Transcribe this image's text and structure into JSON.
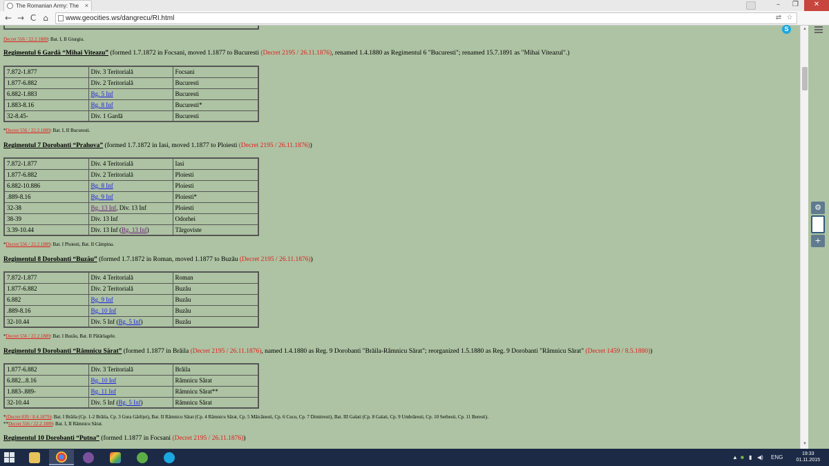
{
  "browser": {
    "tab_title": "The Romanian Army: The",
    "tab_close": "×",
    "url": "www.geocities.ws/dangrecu/RI.html",
    "nav": {
      "back": "←",
      "forward": "→",
      "reload": "C",
      "home": "⌂"
    },
    "window": {
      "minimize": "–",
      "maximize": "❐",
      "close": "✕"
    },
    "skype_label": "S"
  },
  "page": {
    "top_note": {
      "ref": "Decret 556 / 22.2.1889",
      "text": ": Bat. I, II Giurgiu."
    },
    "regiments": [
      {
        "title": "Regimentul 6 Gardă “Mihai Viteazu”",
        "desc": " (formed 1.7.1872 in Focsani, moved 1.1877 to Bucuresti ",
        "decree": "(Decret 2195 / 26.11.1876)",
        "desc2": ", renamed 1.4.1880 as Regimentul 6 \"Bucuresti\"; renamed 15.7.1891 as \"Mihai Viteazul\".)",
        "rows": [
          {
            "period": "7.872-1.877",
            "unit": "Div. 3 Teritorială",
            "unit_link": "",
            "unit_suffix": "",
            "place": "Focsani"
          },
          {
            "period": "1.877-6.882",
            "unit": "Div. 2 Teritorială",
            "unit_link": "",
            "unit_suffix": "",
            "place": "Bucuresti"
          },
          {
            "period": "6.882-1.883",
            "unit": "",
            "unit_link": "Bg. 5 Inf",
            "unit_suffix": "",
            "place": "Bucuresti"
          },
          {
            "period": "1.883-8.16",
            "unit": "",
            "unit_link": "Bg. 8 Inf",
            "unit_suffix": "",
            "place": "Bucuresti*"
          },
          {
            "period": "32-8.45-",
            "unit": "Div. 1 Gardă",
            "unit_link": "",
            "unit_suffix": "",
            "place": "Bucuresti"
          }
        ],
        "notes": [
          {
            "prefix": "*",
            "ref": "Decret 556 / 22.2.1889",
            "text": ": Bat. I, II Bucuresti."
          }
        ]
      },
      {
        "title": "Regimentul 7 Dorobanti “Prahova”",
        "desc": " (formed 1.7.1872 in Iasi, moved 1.1877 to Ploiesti ",
        "decree": "(Decret 2195 / 26.11.1876)",
        "desc2": ")",
        "rows": [
          {
            "period": "7.872-1.877",
            "unit": "Div. 4 Teritorială",
            "unit_link": "",
            "unit_suffix": "",
            "place": "Iasi"
          },
          {
            "period": "1.877-6.882",
            "unit": "Div. 2 Teritorială",
            "unit_link": "",
            "unit_suffix": "",
            "place": "Ploiesti"
          },
          {
            "period": "6.882-10.886",
            "unit": "",
            "unit_link": "Bg. 8 Inf",
            "unit_suffix": "",
            "place": "Ploiesti"
          },
          {
            "period": ".889-8.16",
            "unit": "",
            "unit_link": "Bg. 9 Inf",
            "unit_suffix": "",
            "place": "Ploiesti*"
          },
          {
            "period": "32-38",
            "unit": "",
            "unit_link": "Bg. 13 Inf",
            "unit_suffix": ", Div. 13 Inf",
            "place": "Ploiesti",
            "visited": true
          },
          {
            "period": "38-39",
            "unit": "Div. 13 Inf",
            "unit_link": "",
            "unit_suffix": "",
            "place": "Odorhei"
          },
          {
            "period": "3.39-10.44",
            "unit": "Div. 13 Inf (",
            "unit_link": "Bg. 13 Inf",
            "unit_suffix": ")",
            "place": "Târgoviste",
            "visited": true
          }
        ],
        "notes": [
          {
            "prefix": "*",
            "ref": "Decret 556 / 22.2.1889",
            "text": ": Bat. I Ploiesti, Bat. II Câmpina."
          }
        ]
      },
      {
        "title": "Regimentul 8 Dorobanti “Buzău”",
        "desc": " (formed 1.7.1872 in Roman, moved 1.1877 to Buzău ",
        "decree": "(Decret 2195 / 26.11.1876)",
        "desc2": ")",
        "rows": [
          {
            "period": "7.872-1.877",
            "unit": "Div. 4 Teritorială",
            "unit_link": "",
            "unit_suffix": "",
            "place": "Roman"
          },
          {
            "period": "1.877-6.882",
            "unit": "Div. 2 Teritorială",
            "unit_link": "",
            "unit_suffix": "",
            "place": "Buzău"
          },
          {
            "period": "6.882",
            "unit": "",
            "unit_link": "Bg. 9 Inf",
            "unit_suffix": "",
            "place": "Buzău"
          },
          {
            "period": ".889-8.16",
            "unit": "",
            "unit_link": "Bg. 10 Inf",
            "unit_suffix": "",
            "place": "Buzău"
          },
          {
            "period": "32-10.44",
            "unit": "Div. 5 Inf (",
            "unit_link": "Bg. 5 Inf",
            "unit_suffix": ")",
            "place": "Buzău"
          }
        ],
        "notes": [
          {
            "prefix": "*",
            "ref": "Decret 556 / 22.2.1889",
            "text": ": Bat. I Buzău, Bat. II Pătârlagele."
          }
        ]
      },
      {
        "title": "Regimentul 9 Dorobanti “Râmnicu Sărat”",
        "desc": " (formed 1.1877 in Brăila ",
        "decree": "(Decret 2195 / 26.11.1876)",
        "desc2": ", named 1.4.1880 as Reg. 9 Dorobanti \"Brăila-Râmnicu Sărat\"; reorganized 1.5.1880 as Reg. 9 Dorobanti \"Râmnicu Sărat\" ",
        "decree2": "(Decret 1459 / 8.5.1880)",
        "desc3": ")",
        "rows": [
          {
            "period": "1.877-6.882",
            "unit": "Div. 3 Teritorială",
            "unit_link": "",
            "unit_suffix": "",
            "place": "Brăila"
          },
          {
            "period": "6.882...8.16",
            "unit": "",
            "unit_link": "Bg. 10 Inf",
            "unit_suffix": "",
            "place": "Râmnicu Sărat"
          },
          {
            "period": "1.883-.889-",
            "unit": "",
            "unit_link": "Bg. 11 Inf",
            "unit_suffix": "",
            "place": "Râmnicu Sărat**"
          },
          {
            "period": "32-10.44",
            "unit": "Div. 5 Inf (",
            "unit_link": "Bg. 5 Inf",
            "unit_suffix": ")",
            "place": "Râmnicu Sărat"
          }
        ],
        "notes": [
          {
            "prefix": "*",
            "ref": "(Decret 839 / 8.4.1879)",
            "text": ": Bat. I Brăila (Cp. 1-2 Brăila, Cp. 3 Gura Gârliței), Bat. II Râmnicu Sărat (Cp. 4 Râmnicu Sărat, Cp. 5 Măicănesti, Cp. 6 Cucu, Cp. 7 Dimitresti), Bat. III Galati (Cp. 8 Galati, Cp. 9 Umbrăresti, Cp. 10 Serbesti, Cp. 11 Beresti)."
          },
          {
            "prefix": "**",
            "ref": "Decret 556 / 22.2.1889",
            "text": ": Bat. I, II Râmnicu Sărat."
          }
        ]
      },
      {
        "title": "Regimentul 10 Dorobanti “Putna”",
        "desc": " (formed 1.1877 in Focsani ",
        "decree": "(Decret 2195 / 26.11.1876)",
        "desc2": ")",
        "rows": [],
        "notes": []
      }
    ]
  },
  "taskbar": {
    "tray_lang": "ENG",
    "clock_time": "19:33",
    "clock_date": "01.11.2015"
  }
}
